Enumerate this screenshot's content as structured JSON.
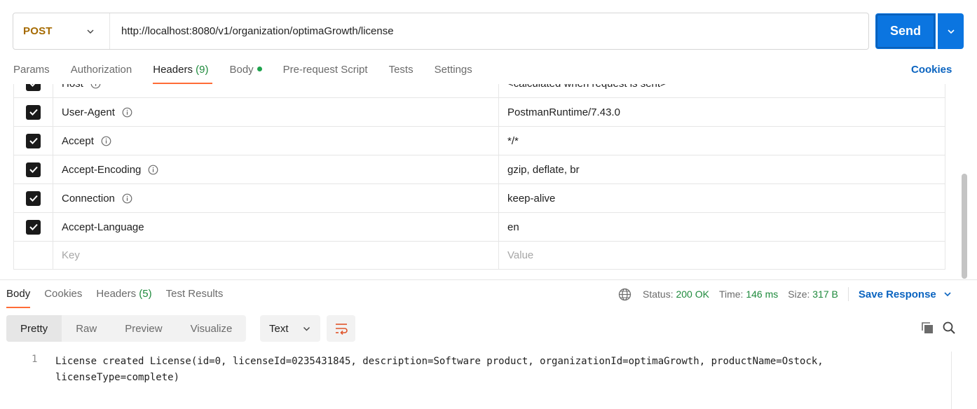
{
  "request": {
    "method": "POST",
    "url": "http://localhost:8080/v1/organization/optimaGrowth/license",
    "send_label": "Send"
  },
  "request_tabs": {
    "params": "Params",
    "authorization": "Authorization",
    "headers": "Headers",
    "headers_count": "(9)",
    "body": "Body",
    "pre_request": "Pre-request Script",
    "tests": "Tests",
    "settings": "Settings",
    "cookies": "Cookies"
  },
  "headers_table": {
    "rows": [
      {
        "key": "Host",
        "value": "<calculated when request is sent>",
        "checked": true,
        "info": true
      },
      {
        "key": "User-Agent",
        "value": "PostmanRuntime/7.43.0",
        "checked": true,
        "info": true
      },
      {
        "key": "Accept",
        "value": "*/*",
        "checked": true,
        "info": true
      },
      {
        "key": "Accept-Encoding",
        "value": "gzip, deflate, br",
        "checked": true,
        "info": true
      },
      {
        "key": "Connection",
        "value": "keep-alive",
        "checked": true,
        "info": true
      },
      {
        "key": "Accept-Language",
        "value": "en",
        "checked": true,
        "info": false
      }
    ],
    "key_placeholder": "Key",
    "value_placeholder": "Value"
  },
  "response_tabs": {
    "body": "Body",
    "cookies": "Cookies",
    "headers": "Headers",
    "headers_count": "(5)",
    "test_results": "Test Results"
  },
  "response_status": {
    "status_label": "Status:",
    "status_value": "200 OK",
    "time_label": "Time:",
    "time_value": "146 ms",
    "size_label": "Size:",
    "size_value": "317 B",
    "save_response": "Save Response"
  },
  "format_tabs": {
    "pretty": "Pretty",
    "raw": "Raw",
    "preview": "Preview",
    "visualize": "Visualize",
    "text_select": "Text"
  },
  "response_body": {
    "line_number": "1",
    "text": "License created License(id=0, licenseId=0235431845, description=Software product, organizationId=optimaGrowth, productName=Ostock, licenseType=complete)"
  },
  "colors": {
    "accent": "#ff6c37",
    "primary": "#0b75e0",
    "success": "#1e8a3c",
    "method_post": "#a56a00"
  }
}
